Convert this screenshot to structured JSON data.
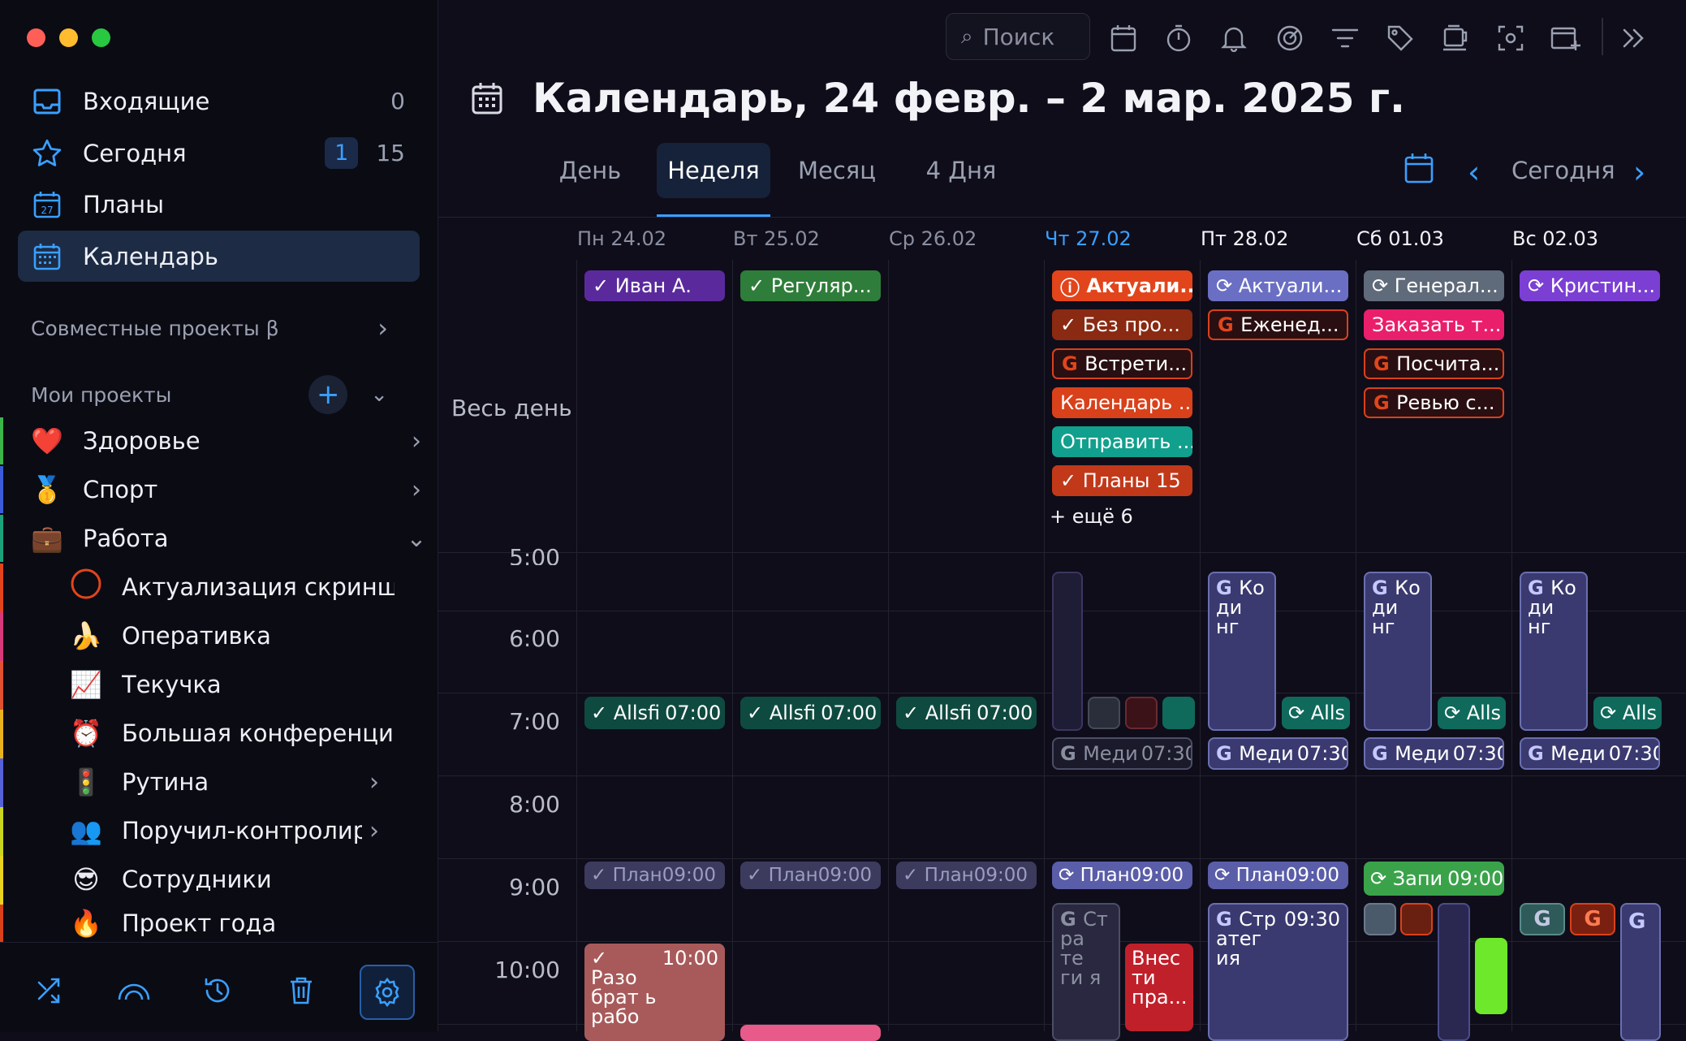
{
  "search": {
    "placeholder": "Поиск"
  },
  "sidebar": {
    "nav": [
      {
        "label": "Входящие",
        "count": "0"
      },
      {
        "label": "Сегодня",
        "badge": "1",
        "count": "15"
      },
      {
        "label": "Планы"
      },
      {
        "label": "Календарь"
      }
    ],
    "shared_projects": "Совместные проекты β",
    "my_projects": "Мои проекты",
    "projects": [
      {
        "emoji": "❤️",
        "label": "Здоровье",
        "chev": "›"
      },
      {
        "emoji": "🥇",
        "label": "Спорт",
        "chev": "›"
      },
      {
        "emoji": "💼",
        "label": "Работа",
        "chev": "⌄"
      },
      {
        "emoji": "",
        "label": "Актуализация скриншот",
        "chev": ""
      },
      {
        "emoji": "🍌",
        "label": "Оперативка",
        "chev": ""
      },
      {
        "emoji": "📈",
        "label": "Текучка",
        "chev": ""
      },
      {
        "emoji": "⏰",
        "label": "Большая конференция г",
        "chev": ""
      },
      {
        "emoji": "🚦",
        "label": "Рутина",
        "chev": "›"
      },
      {
        "emoji": "👥",
        "label": "Поручил-контролиру",
        "chev": "›"
      },
      {
        "emoji": "😎",
        "label": "Сотрудники",
        "chev": ""
      },
      {
        "emoji": "🔥",
        "label": "Проект года",
        "chev": ""
      }
    ]
  },
  "header": {
    "title": "Календарь, 24 февр. – 2 мар. 2025 г."
  },
  "tabs": [
    "День",
    "Неделя",
    "Месяц",
    "4 Дня"
  ],
  "nav_today": "Сегодня",
  "days": [
    "Пн 24.02",
    "Вт 25.02",
    "Ср 26.02",
    "Чт 27.02",
    "Пт 28.02",
    "Сб 01.03",
    "Вс 02.03"
  ],
  "allday_label": "Весь день",
  "hours": [
    "5:00",
    "6:00",
    "7:00",
    "8:00",
    "9:00",
    "10:00"
  ],
  "allday": {
    "mon": [
      "Иван А."
    ],
    "tue": [
      "Регуляр..."
    ],
    "thu": [
      "Актуали...",
      "Без про...",
      "Встрети...",
      "Календарь ...",
      "Отправить ...",
      "Планы 15"
    ],
    "thu_more": "+ ещё 6",
    "fri": [
      "Актуали...",
      "Еженед..."
    ],
    "sat": [
      "Генерал...",
      "Заказать т...",
      "Посчита...",
      "Ревью с..."
    ],
    "sun": [
      "Кристин..."
    ]
  },
  "events": {
    "allsfi": "Allsfi",
    "alls": "Alls",
    "t0700": "07:00",
    "kod": "Ко ди нг",
    "medi": "Меди",
    "t0730": "07:30",
    "plan": "План",
    "t0900": "09:00",
    "zapi": "Запи",
    "strat_thu": "Ст ра те ги я",
    "strat_fri": "Стр атег ия",
    "t0930": "09:30",
    "vnes": "Внес ти пра...",
    "razo": "Разо брат ь рабо",
    "t1000": "10:00"
  },
  "colors": {
    "accent": "#3aa0ff",
    "purple": "#7b3fd4",
    "green": "#2f7d3a",
    "orange": "#d9411b",
    "teal": "#11a08d",
    "lavender": "#5c5fa8",
    "pink": "#e91f6b",
    "today": "#3aa0ff"
  }
}
